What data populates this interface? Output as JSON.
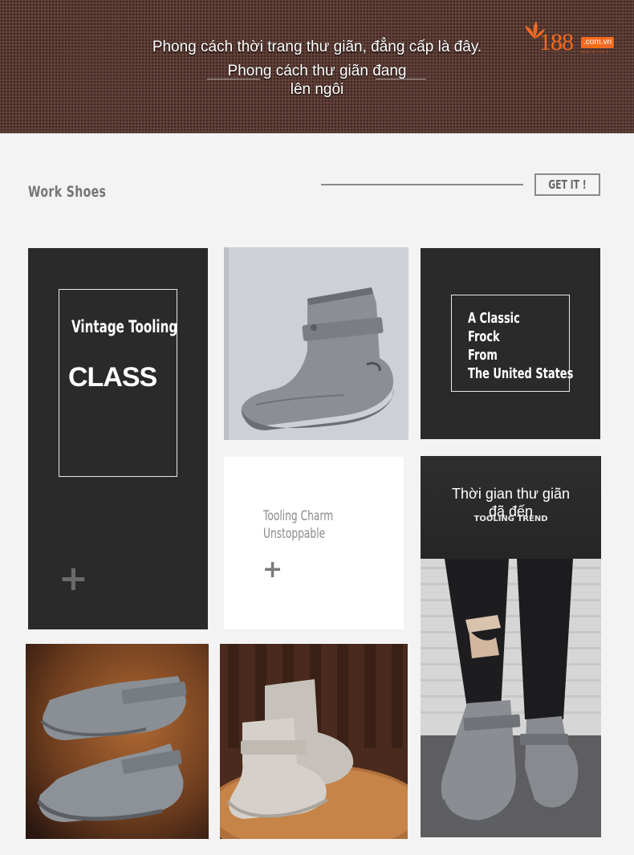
{
  "banner": {
    "line1": "Phong cách thời trang thư giãn, đẳng cấp là đây.",
    "line2a": "Phong cách thư giãn đang",
    "line2b": "lên ngôi"
  },
  "logo": {
    "number": "188",
    "domain": ".com.vn",
    "sub": "MUA SỈ TỪ 1"
  },
  "section": {
    "title": "Work Shoes",
    "cta": "GET IT !"
  },
  "tiles": {
    "vintage": {
      "line1": "Vintage Tooling",
      "line2": "CLASS",
      "plus": "+"
    },
    "classic": {
      "lines": [
        "A Classic",
        "Frock",
        "From",
        "The United States"
      ]
    },
    "charm": {
      "line1": "Tooling Charm",
      "line2": "Unstoppable",
      "plus": "+"
    },
    "trend": {
      "caption1": "Thời gian thư giãn",
      "caption2": "đã đến",
      "tag": "TOOLING TREND"
    }
  },
  "colors": {
    "brand_orange": "#f26a21",
    "tile_dark": "#2a2a2a",
    "banner_brown": "#5b3b33"
  },
  "icons": [
    "logo-leaf-icon",
    "plus-icon",
    "boot-photo"
  ]
}
